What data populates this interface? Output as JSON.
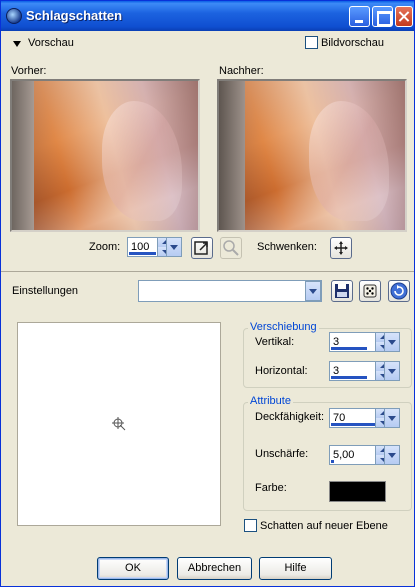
{
  "window": {
    "title": "Schlagschatten"
  },
  "preview": {
    "section_label": "Vorschau",
    "image_preview_label": "Bildvorschau",
    "image_preview_checked": false,
    "before_label": "Vorher:",
    "after_label": "Nachher:",
    "zoom_label": "Zoom:",
    "zoom_value": "100",
    "pan_label": "Schwenken:"
  },
  "settings": {
    "label": "Einstellungen",
    "value": ""
  },
  "offset": {
    "legend": "Verschiebung",
    "vertical_label": "Vertikal:",
    "vertical_value": "3",
    "horizontal_label": "Horizontal:",
    "horizontal_value": "3"
  },
  "attributes": {
    "legend": "Attribute",
    "opacity_label": "Deckfähigkeit:",
    "opacity_value": "70",
    "blur_label": "Unschärfe:",
    "blur_value": "5,00",
    "color_label": "Farbe:",
    "color_value": "#000000"
  },
  "shadow_new_layer": {
    "label": "Schatten auf neuer Ebene",
    "checked": false
  },
  "buttons": {
    "ok": "OK",
    "cancel": "Abbrechen",
    "help": "Hilfe"
  },
  "colors": {
    "titlebar": "#0a5fe6",
    "accent": "#0046d5",
    "dialog_bg": "#ece9d8"
  }
}
